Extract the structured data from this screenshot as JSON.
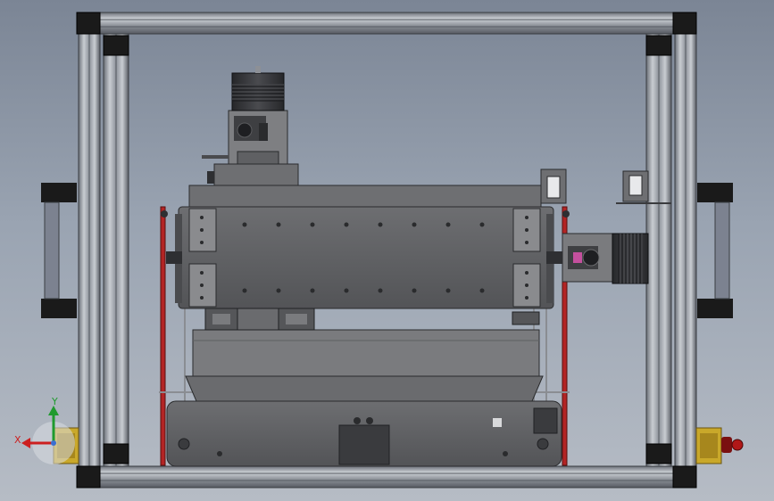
{
  "axes": {
    "x_label": "X",
    "y_label": "Y"
  },
  "colors": {
    "background_top": "#7b8595",
    "background_bottom": "#b6bcc5",
    "frame_light": "#aeb3ba",
    "frame_dark": "#4a4e55",
    "corner_block": "#1a1a1a",
    "machine_body": "#5f6063",
    "machine_body_light": "#7a7b7e",
    "red_rail": "#b32424",
    "motor_dark": "#2e2f32",
    "axis_x": "#cc1f1f",
    "axis_y": "#1f9a2e",
    "yellow_block": "#c9a82a"
  },
  "icons": {
    "triad": "axis-triad-icon",
    "motor": "stepper-motor-icon"
  }
}
